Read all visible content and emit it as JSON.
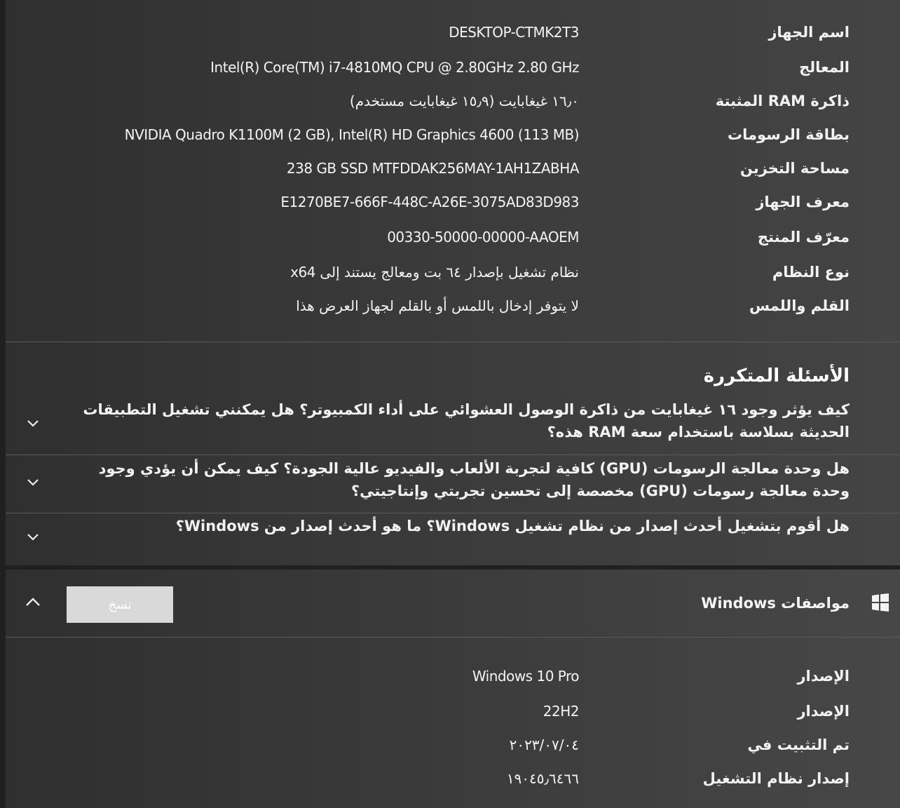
{
  "device_specs": [
    {
      "label": "اسم الجهاز",
      "value": "DESKTOP-CTMK2T3"
    },
    {
      "label": "المعالج",
      "value": "Intel(R) Core(TM) i7-4810MQ CPU @ 2.80GHz   2.80 GHz"
    },
    {
      "label": "ذاكرة RAM المثبتة",
      "value": "١٦٫٠ غيغابايت (١٥٫٩ غيغابايت مستخدم)"
    },
    {
      "label": "بطاقة الرسومات",
      "value": "NVIDIA Quadro K1100M (2 GB), Intel(R) HD Graphics 4600 (113 MB)"
    },
    {
      "label": "مساحة التخزين",
      "value": "238 GB SSD MTFDDAK256MAY-1AH1ZABHA"
    },
    {
      "label": "معرف الجهاز",
      "value": "E1270BE7-666F-448C-A26E-3075AD83D983"
    },
    {
      "label": "معرّف المنتج",
      "value": "00330-50000-00000-AAOEM"
    },
    {
      "label": "نوع النظام",
      "value": "نظام تشغيل بإصدار ٦٤ بت ومعالج يستند إلى x64"
    },
    {
      "label": "القلم واللمس",
      "value": "لا يتوفر إدخال باللمس أو بالقلم لجهاز العرض هذا"
    }
  ],
  "faq": {
    "heading": "الأسئلة المتكررة",
    "items": [
      {
        "question": "كيف يؤثر وجود ١٦ غيغابايت من ذاكرة الوصول العشوائي على أداء الكمبيوتر؟ هل يمكنني تشغيل التطبيقات الحديثة بسلاسة باستخدام سعة RAM هذه؟"
      },
      {
        "question": "هل وحدة معالجة الرسومات (GPU) كافية لتجربة الألعاب والفيديو عالية الجودة؟ كيف يمكن أن يؤدي وجود وحدة معالجة رسومات (GPU) مخصصة إلى تحسين تجربتي وإنتاجيتي؟"
      },
      {
        "question": "هل أقوم بتشغيل أحدث إصدار من نظام تشغيل Windows؟ ما هو أحدث إصدار من Windows؟"
      }
    ]
  },
  "windows_section": {
    "title": "مواصفات Windows",
    "copy_label": "نسخ",
    "specs": [
      {
        "label": "الإصدار",
        "value": "Windows 10 Pro"
      },
      {
        "label": "الإصدار",
        "value": "22H2"
      },
      {
        "label": "تم التثبيت في",
        "value": "٢٠٢٣/٠٧/٠٤"
      },
      {
        "label": "إصدار نظام التشغيل",
        "value": "١٩٠٤٥٫٦٤٦٦"
      }
    ]
  },
  "icons": {
    "expand": "chevron-down-icon",
    "collapse": "chevron-up-icon",
    "section": "windows-logo-icon"
  }
}
